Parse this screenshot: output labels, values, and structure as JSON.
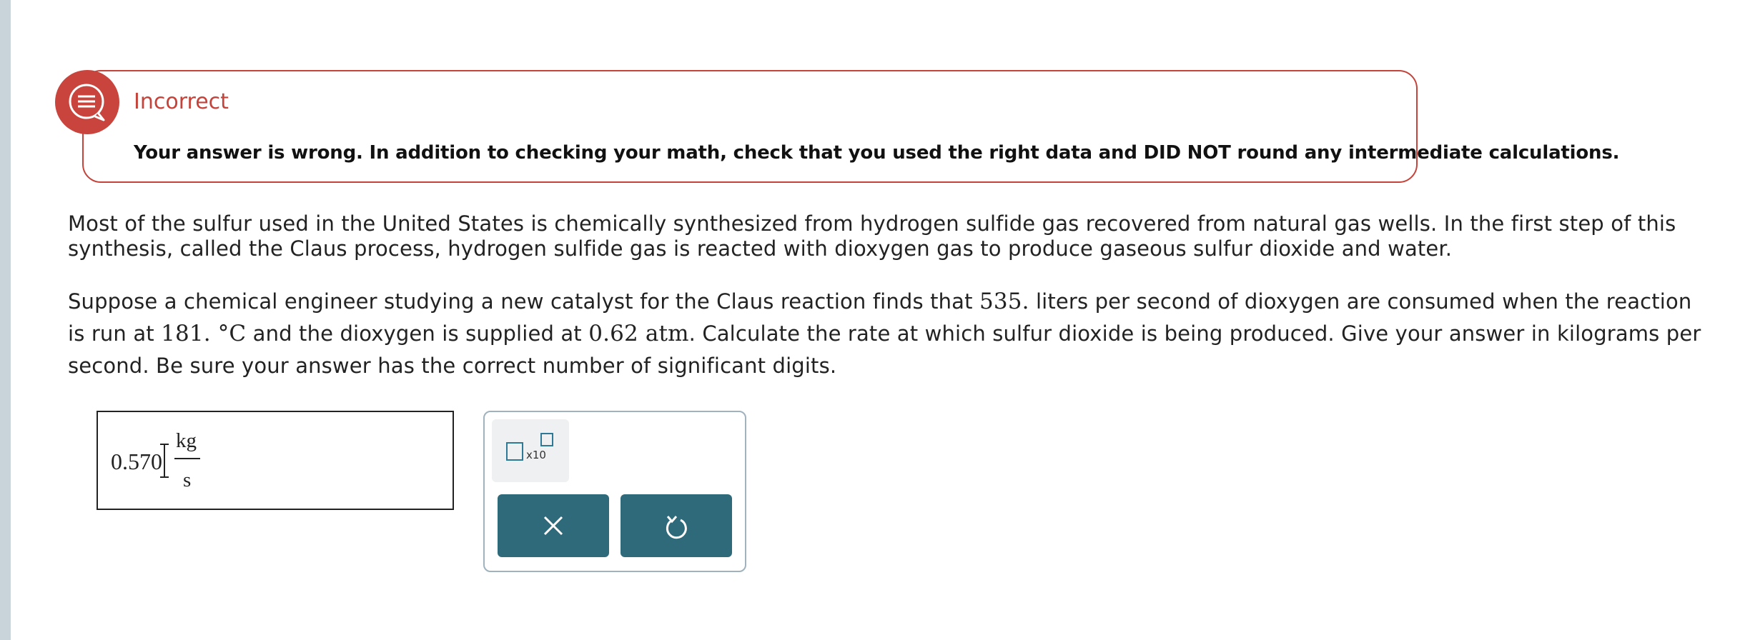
{
  "feedback": {
    "icon": "chat-bubble-icon",
    "title": "Incorrect",
    "message": "Your answer is wrong. In addition to checking your math, check that you used the right data and DID NOT round any intermediate calculations.",
    "color": "#c4433a"
  },
  "question": {
    "paragraph1": "Most of the sulfur used in the United States is chemically synthesized from hydrogen sulfide gas recovered from natural gas wells. In the first step of this synthesis, called the Claus process, hydrogen sulfide gas is reacted with dioxygen gas to produce gaseous sulfur dioxide and water.",
    "p2_a": "Suppose a chemical engineer studying a new catalyst for the Claus reaction finds that ",
    "p2_rate": "535.",
    "p2_b": " liters per second of dioxygen are consumed when the reaction is run at ",
    "p2_temp": "181. °C",
    "p2_c": " and the dioxygen is supplied at ",
    "p2_pressure": "0.62 atm",
    "p2_d": ". Calculate the rate at which sulfur dioxide is being produced. Give your answer in kilograms per second. Be sure your answer has the correct number of significant digits."
  },
  "answer": {
    "value": "0.570",
    "unit_numerator": "kg",
    "unit_denominator": "s"
  },
  "tools": {
    "x10_label": "x10",
    "x10_icon": "scientific-notation-icon",
    "clear_icon": "close-icon",
    "undo_icon": "undo-icon",
    "button_color": "#2f6a7a"
  }
}
